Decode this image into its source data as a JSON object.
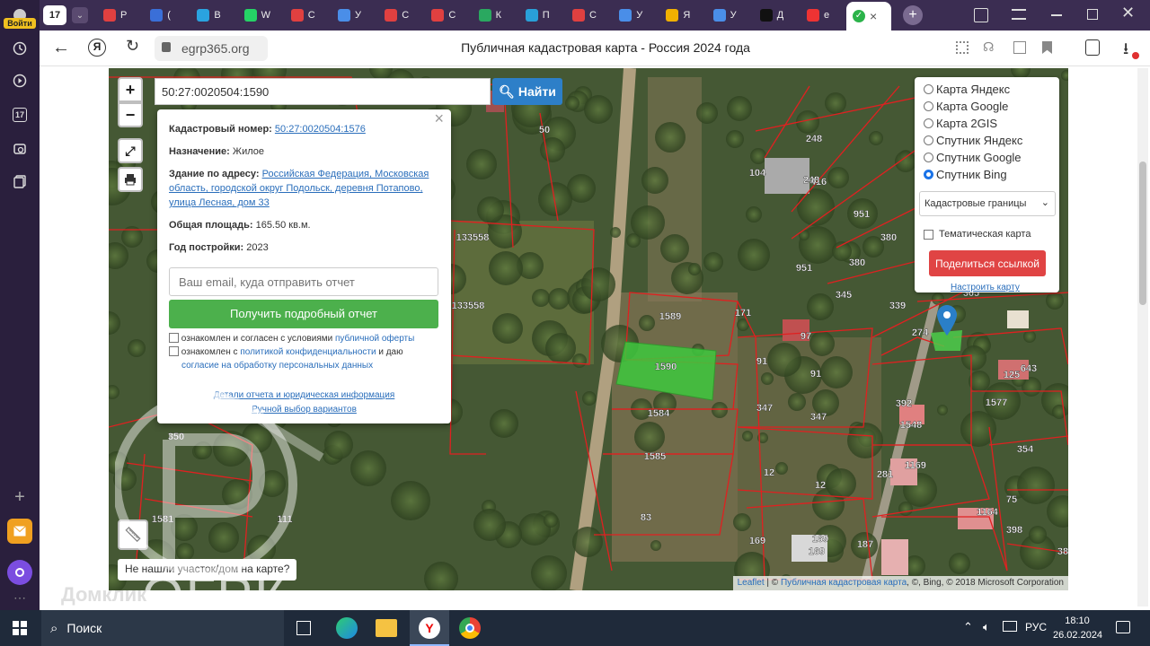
{
  "sidebar": {
    "profile_label": "Войти",
    "badge": "17"
  },
  "tabs": {
    "counter": "17",
    "items": [
      {
        "label": "Р",
        "color": "#e04040"
      },
      {
        "label": "(",
        "color": "#3a6fd8"
      },
      {
        "label": "В",
        "color": "#2aa3e0"
      },
      {
        "label": "W",
        "color": "#25d366"
      },
      {
        "label": "С",
        "color": "#e04040"
      },
      {
        "label": "У",
        "color": "#4a8ee8"
      },
      {
        "label": "С",
        "color": "#e04040"
      },
      {
        "label": "С",
        "color": "#e04040"
      },
      {
        "label": "К",
        "color": "#2aa860"
      },
      {
        "label": "П",
        "color": "#29a0d8"
      },
      {
        "label": "С",
        "color": "#e04040"
      },
      {
        "label": "У",
        "color": "#4a8ee8"
      },
      {
        "label": "Я",
        "color": "#f0b000"
      },
      {
        "label": "У",
        "color": "#4a8ee8"
      },
      {
        "label": "Д",
        "color": "#111111"
      },
      {
        "label": "е",
        "color": "#ee3333"
      }
    ],
    "active_check": "✓",
    "close": "×",
    "new_tab": "+"
  },
  "address": {
    "url": "egrp365.org",
    "page_title": "Публичная кадастровая карта - Россия 2024 года"
  },
  "map": {
    "search_value": "50:27:0020504:1590",
    "search_button": "Найти",
    "zoom_in": "+",
    "zoom_out": "−",
    "missing_link": "Не нашли участок/дом на карте?",
    "attribution": {
      "leaflet": "Leaflet",
      "sep": "| ©",
      "link": "Публичная кадастровая карта",
      "rest": ", ©, Bing, © 2018 Microsoft Corporation"
    },
    "parcel_labels": [
      "50",
      "248",
      "104",
      "416",
      "951",
      "380",
      "133558",
      "133558",
      "1589",
      "171",
      "97",
      "91",
      "91",
      "347",
      "347",
      "1584",
      "1585",
      "12",
      "12",
      "83",
      "169",
      "169",
      "187",
      "1581",
      "350",
      "1590",
      "345",
      "339",
      "274",
      "380",
      "951",
      "248",
      "365",
      "125",
      "643",
      "392",
      "1548",
      "1577",
      "354",
      "281",
      "1169",
      "75",
      "1164",
      "398",
      "38",
      "111",
      "169",
      "1590"
    ]
  },
  "popup": {
    "close": "×",
    "cad_label": "Кадастровый номер:",
    "cad_value": "50:27:0020504:1576",
    "purpose_label": "Назначение:",
    "purpose_value": "Жилое",
    "address_label": "Здание по адресу:",
    "address_value": "Российская Федерация, Московская область, городской округ Подольск, деревня Потапово, улица Лесная, дом 33",
    "area_label": "Общая площадь:",
    "area_value": "165.50 кв.м.",
    "year_label": "Год постройки:",
    "year_value": "2023",
    "email_placeholder": "Ваш email, куда отправить отчет",
    "report_button": "Получить подробный отчет",
    "consent1_text": "ознакомлен и согласен с условиями",
    "consent1_link": "публичной оферты",
    "consent2_text": "ознакомлен с",
    "consent2_link": "политикой конфиденциальности",
    "consent2_text2": "и даю",
    "consent2_link2": "согласие на обработку персональных данных",
    "details_link_a": "Детали",
    "details_link_b": "отчета и юридическая информация",
    "manual_link": "Ручной выбор вариантов"
  },
  "layers": {
    "options": [
      {
        "label": "Карта Яндекс",
        "selected": false
      },
      {
        "label": "Карта Google",
        "selected": false
      },
      {
        "label": "Карта 2GIS",
        "selected": false
      },
      {
        "label": "Спутник Яндекс",
        "selected": false
      },
      {
        "label": "Спутник Google",
        "selected": false
      },
      {
        "label": "Спутник Bing",
        "selected": true
      }
    ],
    "select_value": "Кадастровые границы",
    "thematic_label": "Тематическая карта",
    "share_button": "Поделиться ссылкой",
    "configure_link": "Настроить карту"
  },
  "watermark": {
    "letters": "ОГРК",
    "brand": "Домклик"
  },
  "taskbar": {
    "search_label": "Поиск",
    "lang": "РУС",
    "time": "18:10",
    "date": "26.02.2024"
  },
  "colors": {
    "green": "#4cb04c",
    "blue": "#2a7fc8",
    "red": "#e04444",
    "sidebar": "#2a1f3d",
    "tabbar": "#3b2d52"
  }
}
